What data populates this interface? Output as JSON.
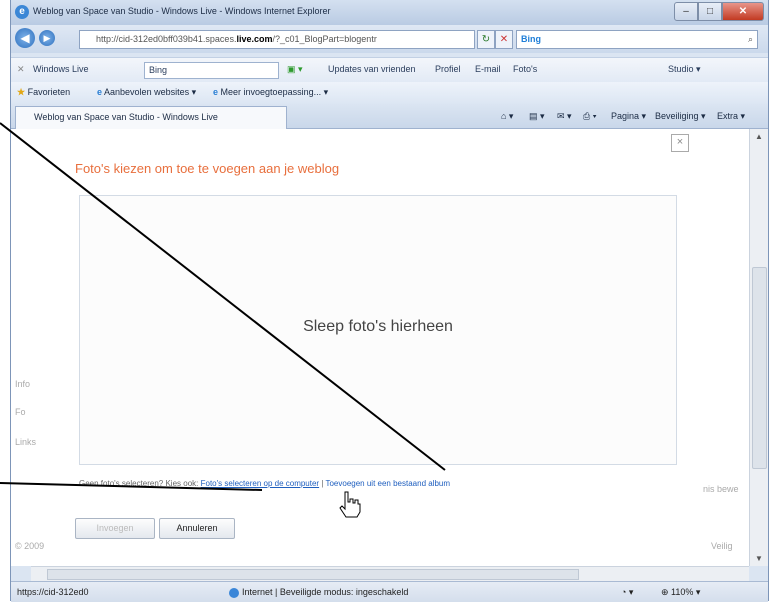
{
  "window": {
    "title": "Weblog van Space van Studio - Windows Live - Windows Internet Explorer",
    "controls": {
      "min": "–",
      "max": "□",
      "close": "✕"
    }
  },
  "address_bar": {
    "url_prefix": "http://cid-312ed0bff039b41.spaces.",
    "url_domain": "live.com",
    "url_suffix": "/?_c01_BlogPart=blogentr",
    "search_engine": "Bing"
  },
  "live_toolbar": {
    "brand": "Windows Live",
    "search_value": "Bing",
    "links": [
      "Updates van vrienden",
      "Profiel",
      "E-mail",
      "Foto's"
    ],
    "studio": "Studio ▾"
  },
  "favorites_bar": {
    "favorites": "Favorieten",
    "suggested": "Aanbevolen websites ▾",
    "gallery": "Meer invoegtoepassing... ▾"
  },
  "tab": {
    "label": "Weblog van Space van Studio - Windows Live"
  },
  "command_bar": {
    "page": "Pagina ▾",
    "safety": "Beveiliging ▾",
    "tools": "Extra ▾"
  },
  "dialog": {
    "title": "Foto's kiezen om toe te voegen aan je weblog",
    "drop_text": "Sleep foto's hierheen",
    "hint_prefix": "Geen foto's selecteren? Kies ook:",
    "select_link": "Foto's selecteren op de computer",
    "separator": " | ",
    "album_link": "Toevoegen uit een bestaand album",
    "insert_button": "Invoegen",
    "cancel_button": "Annuleren"
  },
  "background_text": {
    "left1": "Info",
    "left2": "Fo",
    "left3": "Links",
    "left4": "© 2009",
    "right1": "nis bewe",
    "right2": "Veilig"
  },
  "status_bar": {
    "url": "https://cid-312ed0",
    "zone": "Internet | Beveiligde modus: ingeschakeld",
    "zoom": "110%"
  },
  "colors": {
    "accent_orange": "#e86f3d",
    "link_blue": "#1f5fbf"
  }
}
